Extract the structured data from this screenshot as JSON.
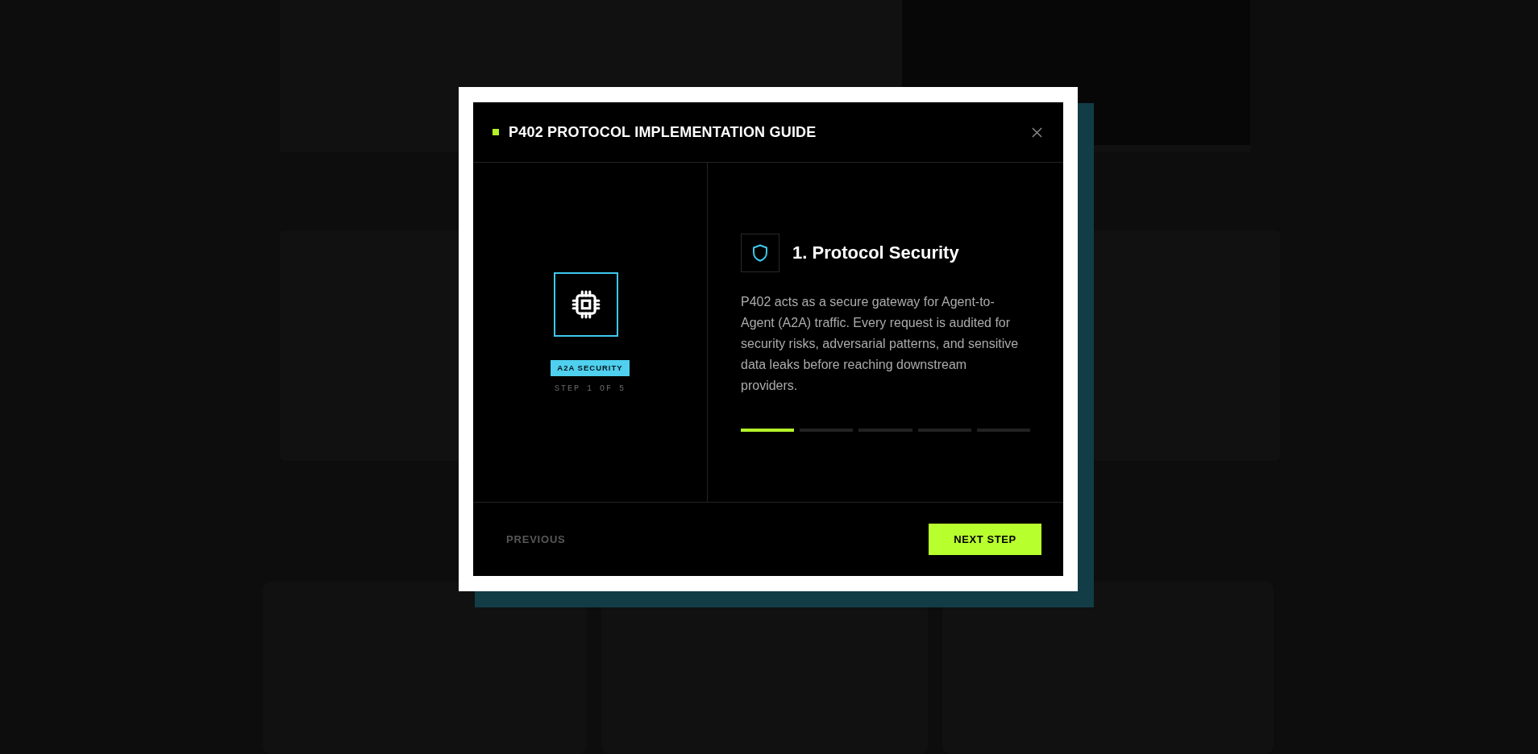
{
  "modal": {
    "title": "P402 PROTOCOL IMPLEMENTATION GUIDE"
  },
  "step_card": {
    "badge": "A2A SECURITY",
    "step_counter": "STEP 1 OF 5"
  },
  "content": {
    "heading": "1. Protocol Security",
    "body": "P402 acts as a secure gateway for Agent-to-Agent (A2A) traffic. Every request is audited for security risks, adversarial patterns, and sensitive data leaks before reaching downstream providers.",
    "progress": [
      {
        "active": true
      },
      {
        "active": false
      },
      {
        "active": false
      },
      {
        "active": false
      },
      {
        "active": false
      }
    ]
  },
  "footer": {
    "previous": {
      "label": "PREVIOUS",
      "disabled": true
    },
    "next": {
      "label": "NEXT STEP"
    }
  }
}
